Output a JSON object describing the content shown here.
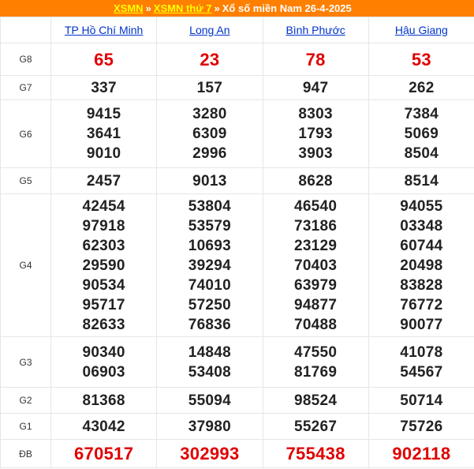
{
  "breadcrumb": {
    "link1": "XSMN",
    "separator": "»",
    "link2": "XSMN thứ 7",
    "text": "Xổ số miền Nam 26-4-2025"
  },
  "provinces": [
    "TP Hồ Chí Minh",
    "Long An",
    "Bình Phước",
    "Hậu Giang"
  ],
  "prizes": [
    {
      "label": "G8",
      "key": "g8",
      "red": true,
      "values": [
        [
          "65"
        ],
        [
          "23"
        ],
        [
          "78"
        ],
        [
          "53"
        ]
      ]
    },
    {
      "label": "G7",
      "key": "g7",
      "red": false,
      "values": [
        [
          "337"
        ],
        [
          "157"
        ],
        [
          "947"
        ],
        [
          "262"
        ]
      ]
    },
    {
      "label": "G6",
      "key": "g6",
      "red": false,
      "values": [
        [
          "9415",
          "3641",
          "9010"
        ],
        [
          "3280",
          "6309",
          "2996"
        ],
        [
          "8303",
          "1793",
          "3903"
        ],
        [
          "7384",
          "5069",
          "8504"
        ]
      ]
    },
    {
      "label": "G5",
      "key": "g5",
      "red": false,
      "values": [
        [
          "2457"
        ],
        [
          "9013"
        ],
        [
          "8628"
        ],
        [
          "8514"
        ]
      ]
    },
    {
      "label": "G4",
      "key": "g4",
      "red": false,
      "values": [
        [
          "42454",
          "97918",
          "62303",
          "29590",
          "90534",
          "95717",
          "82633"
        ],
        [
          "53804",
          "53579",
          "10693",
          "39294",
          "74010",
          "57250",
          "76836"
        ],
        [
          "46540",
          "73186",
          "23129",
          "70403",
          "63979",
          "94877",
          "70488"
        ],
        [
          "94055",
          "03348",
          "60744",
          "20498",
          "83828",
          "76772",
          "90077"
        ]
      ]
    },
    {
      "label": "G3",
      "key": "g3",
      "red": false,
      "values": [
        [
          "90340",
          "06903"
        ],
        [
          "14848",
          "53408"
        ],
        [
          "47550",
          "81769"
        ],
        [
          "41078",
          "54567"
        ]
      ]
    },
    {
      "label": "G2",
      "key": "g2",
      "red": false,
      "values": [
        [
          "81368"
        ],
        [
          "55094"
        ],
        [
          "98524"
        ],
        [
          "50714"
        ]
      ]
    },
    {
      "label": "G1",
      "key": "g1",
      "red": false,
      "values": [
        [
          "43042"
        ],
        [
          "37980"
        ],
        [
          "55267"
        ],
        [
          "75726"
        ]
      ]
    },
    {
      "label": "ĐB",
      "key": "db",
      "red": true,
      "values": [
        [
          "670517"
        ],
        [
          "302993"
        ],
        [
          "755438"
        ],
        [
          "902118"
        ]
      ]
    }
  ]
}
